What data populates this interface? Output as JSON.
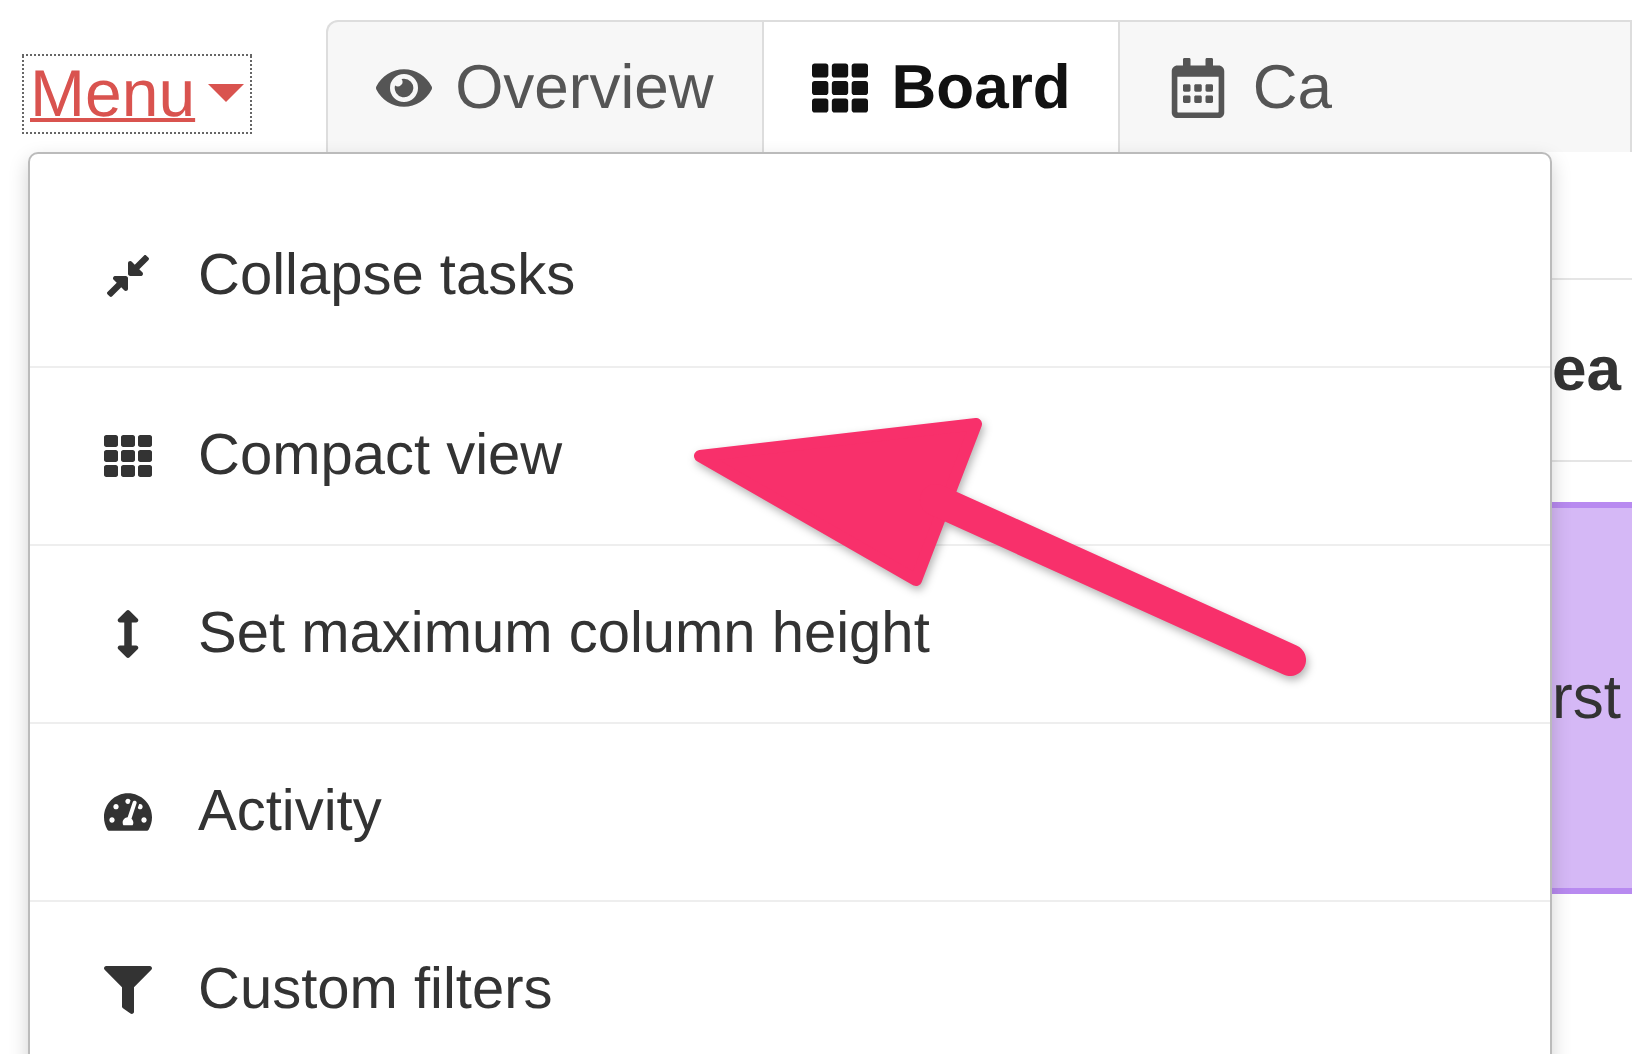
{
  "menu_link": {
    "label": "Menu"
  },
  "tabs": [
    {
      "label": "Overview",
      "selected": false
    },
    {
      "label": "Board",
      "selected": true
    },
    {
      "label": "Ca",
      "selected": false
    }
  ],
  "board": {
    "column_header": "ea",
    "card_text": "rst"
  },
  "dropdown": {
    "items": [
      {
        "label": "Collapse tasks"
      },
      {
        "label": "Compact view"
      },
      {
        "label": "Set maximum column height"
      },
      {
        "label": "Activity"
      },
      {
        "label": "Custom filters"
      }
    ]
  }
}
